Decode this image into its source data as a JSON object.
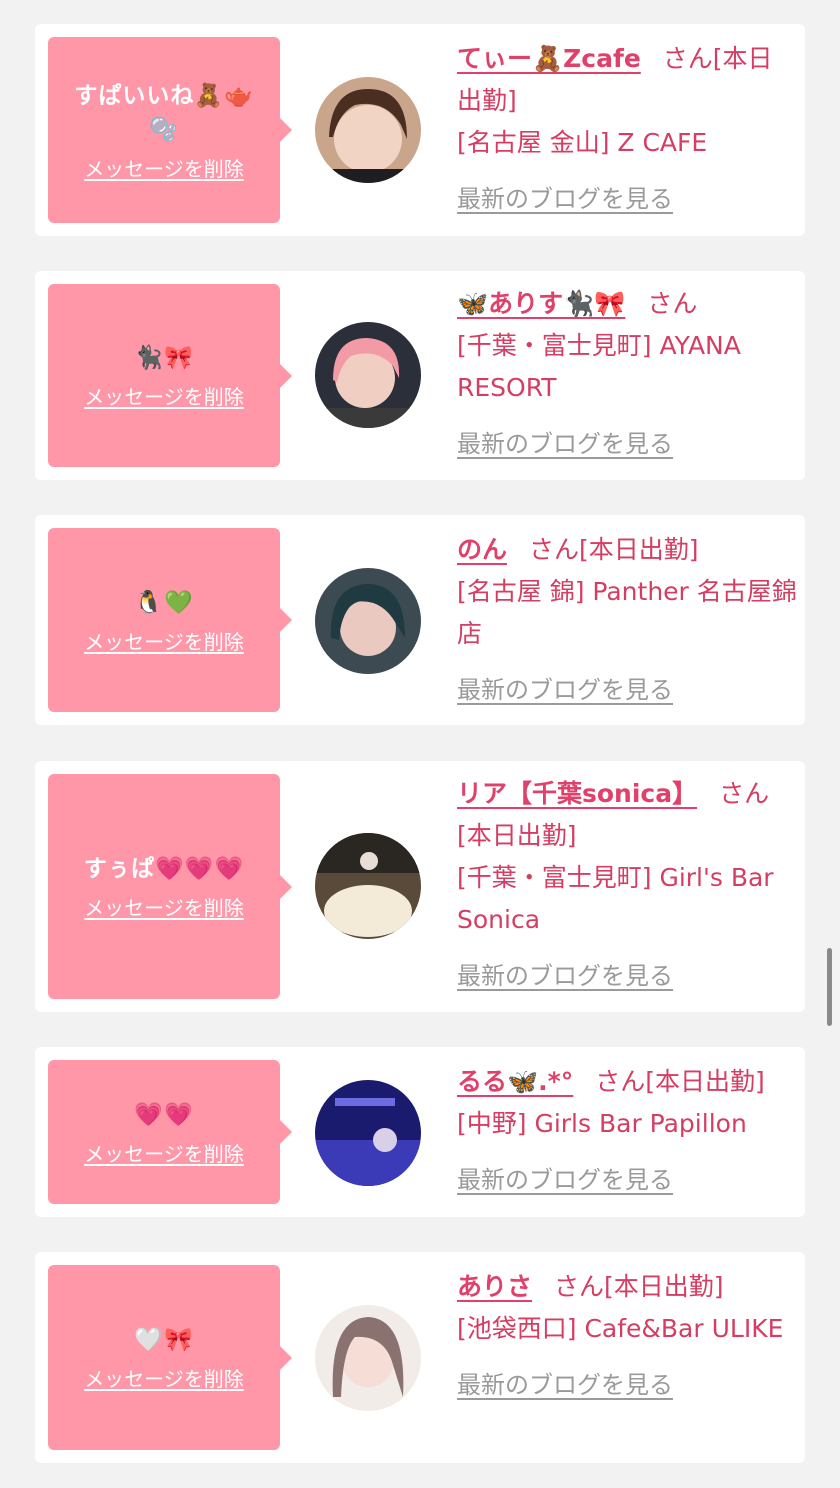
{
  "items": [
    {
      "message": "すぱいいね🧸🫖🫧",
      "delete_label": "メッセージを削除",
      "name": "てぃー🧸Zcafe",
      "san": "さん",
      "status": "[本日出勤]",
      "shop": "[名古屋 金山] Z CAFE",
      "blog_label": "最新のブログを見る"
    },
    {
      "message": "🐈‍⬛🎀",
      "delete_label": "メッセージを削除",
      "name": "🦋ありす🐈‍⬛🎀",
      "san": "さん",
      "status": "",
      "shop": "[千葉・富士見町] AYANA RESORT",
      "blog_label": "最新のブログを見る"
    },
    {
      "message": "🐧💚",
      "delete_label": "メッセージを削除",
      "name": "のん",
      "san": "さん",
      "status": "[本日出勤]",
      "shop": "[名古屋 錦] Panther 名古屋錦店",
      "blog_label": "最新のブログを見る"
    },
    {
      "message": "すぅぱ💗💗💗",
      "delete_label": "メッセージを削除",
      "name": "リア【千葉sonica】",
      "san": "さん",
      "status": "[本日出勤]",
      "shop": "[千葉・富士見町] Girl's Bar Sonica",
      "blog_label": "最新のブログを見る"
    },
    {
      "message": "💗💗",
      "delete_label": "メッセージを削除",
      "name": "るる🦋.*°",
      "san": "さん",
      "status": "[本日出勤]",
      "shop": "[中野] Girls Bar Papillon",
      "blog_label": "最新のブログを見る"
    },
    {
      "message": "🤍🎀",
      "delete_label": "メッセージを削除",
      "name": "ありさ",
      "san": "さん",
      "status": "[本日出勤]",
      "shop": "[池袋西口] Cafe&Bar ULIKE",
      "blog_label": "最新のブログを見る"
    }
  ]
}
